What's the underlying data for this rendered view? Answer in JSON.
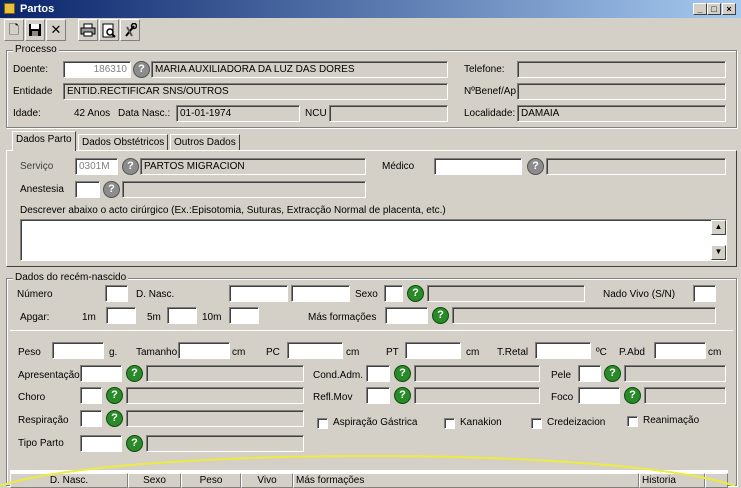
{
  "window": {
    "title": "Partos",
    "min": "_",
    "max": "□",
    "close": "×"
  },
  "toolbar": [
    "new-document-icon",
    "save-icon",
    "delete-icon",
    "print-icon",
    "print-preview-icon",
    "tools-icon"
  ],
  "processo": {
    "legend": "Processo",
    "doente_label": "Doente:",
    "doente_num": "186310",
    "doente_nome": "MARIA AUXILIADORA DA LUZ DAS DORES",
    "telefone_label": "Telefone:",
    "telefone": "",
    "entidade_label": "Entidade",
    "entidade": "ENTID.RECTIFICAR SNS/OUTROS",
    "nbenef_label": "NºBenef/Ap",
    "nbenef": "",
    "idade_label": "Idade:",
    "idade": "42 Anos",
    "datanasc_label": "Data Nasc.:",
    "datanasc": "01-01-1974",
    "ncu_label": "NCU",
    "ncu": "",
    "localidade_label": "Localidade:",
    "localidade": "DAMAIA"
  },
  "tabs": [
    "Dados Parto",
    "Dados Obstétricos",
    "Outros Dados"
  ],
  "parto": {
    "servico_label": "Serviço",
    "servico_code": "0301M",
    "servico_nome": "PARTOS MIGRACION",
    "medico_label": "Médico",
    "medico": "",
    "medico_nome": "",
    "anestesia_label": "Anestesia",
    "anestesia": "",
    "anestesia_nome": "",
    "descrever_label": "Descrever abaixo o acto cirúrgico (Ex.:Episotomia, Suturas, Extracção Normal de placenta, etc.)",
    "descricao": ""
  },
  "recem": {
    "legend": "Dados do recém-nascido",
    "numero_label": "Número",
    "dnasc_label": "D. Nasc.",
    "sexo_label": "Sexo",
    "nadovivo_label": "Nado Vivo (S/N)",
    "apgar_label": "Apgar:",
    "m1": "1m",
    "m5": "5m",
    "m10": "10m",
    "malformacoes_label": "Más formações",
    "peso_label": "Peso",
    "peso_unit": "g.",
    "tamanho_label": "Tamanho",
    "tamanho_unit": "cm",
    "pc_label": "PC",
    "pc_unit": "cm",
    "pt_label": "PT",
    "pt_unit": "cm",
    "tretal_label": "T.Retal",
    "tretal_unit": "ºC",
    "pabd_label": "P.Abd",
    "pabd_unit": "cm",
    "apresentacao_label": "Apresentação",
    "condadm_label": "Cond.Adm.",
    "pele_label": "Pele",
    "choro_label": "Choro",
    "reflmov_label": "Refl.Mov",
    "foco_label": "Foco",
    "respiracao_label": "Respiração",
    "aspiracao_label": "Aspiração Gástrica",
    "kanakion_label": "Kanakion",
    "credeizacion_label": "Credeizacion",
    "reanimacao_label": "Reanimação",
    "tipoparto_label": "Tipo Parto"
  },
  "grid": {
    "columns": [
      "D. Nasc.",
      "Sexo",
      "Peso",
      "Vivo",
      "Más formações",
      "Historia"
    ]
  },
  "scroll": {
    "up": "▲",
    "down": "▼"
  },
  "help_glyph": "?",
  "colors": {
    "titlebar": "#0a246a",
    "help_green": "#2a8a2a",
    "window_bg": "#d4d0c8",
    "annotation_curve": "#ecec40"
  }
}
